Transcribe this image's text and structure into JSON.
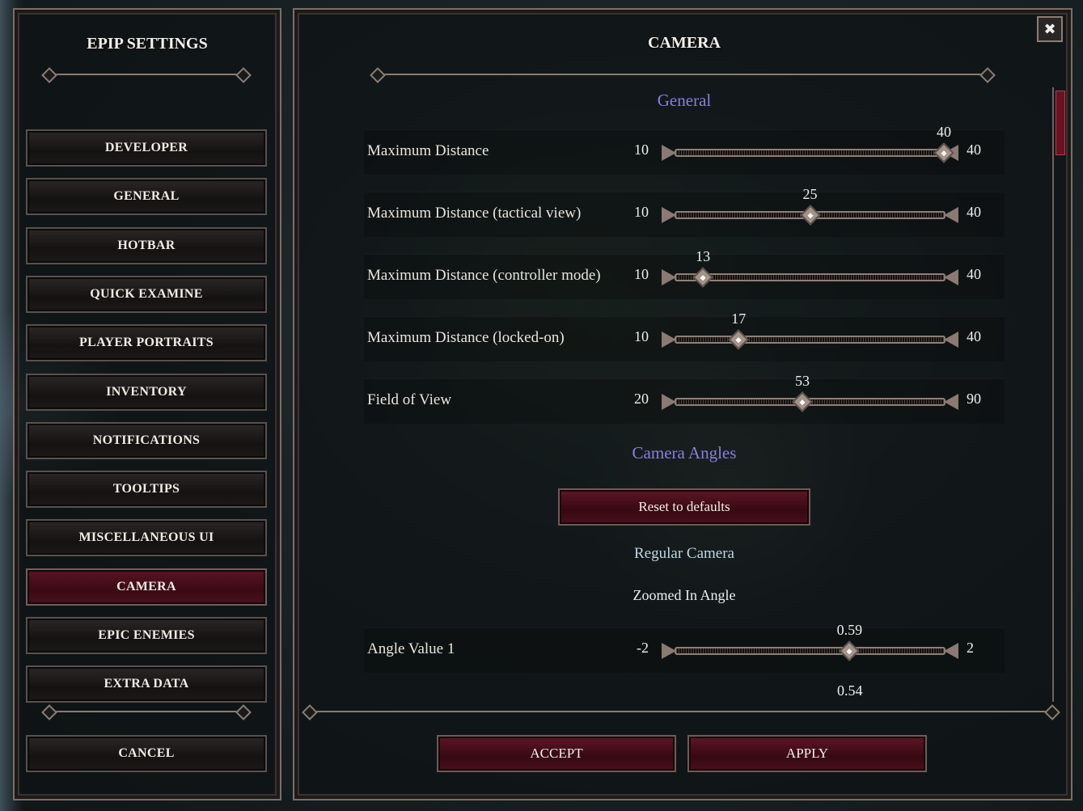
{
  "sidebar": {
    "title": "EPIP SETTINGS",
    "items": [
      {
        "label": "DEVELOPER"
      },
      {
        "label": "GENERAL"
      },
      {
        "label": "HOTBAR"
      },
      {
        "label": "QUICK EXAMINE"
      },
      {
        "label": "PLAYER PORTRAITS"
      },
      {
        "label": "INVENTORY"
      },
      {
        "label": "NOTIFICATIONS"
      },
      {
        "label": "TOOLTIPS"
      },
      {
        "label": "MISCELLANEOUS UI"
      },
      {
        "label": "CAMERA",
        "active": true
      },
      {
        "label": "EPIC ENEMIES"
      },
      {
        "label": "EXTRA DATA"
      }
    ],
    "cancel_label": "CANCEL"
  },
  "main": {
    "title": "CAMERA",
    "close_icon": "close-icon",
    "section_general": "General",
    "sliders": [
      {
        "label": "Maximum Distance",
        "min": "10",
        "max": "40",
        "value": "40"
      },
      {
        "label": "Maximum Distance (tactical view)",
        "min": "10",
        "max": "40",
        "value": "25"
      },
      {
        "label": "Maximum Distance (controller mode)",
        "min": "10",
        "max": "40",
        "value": "13"
      },
      {
        "label": "Maximum Distance (locked-on)",
        "min": "10",
        "max": "40",
        "value": "17"
      },
      {
        "label": "Field of View",
        "min": "20",
        "max": "90",
        "value": "53"
      }
    ],
    "section_angles": "Camera Angles",
    "reset_label": "Reset to defaults",
    "regular_camera": "Regular Camera",
    "zoomed_in_angle": "Zoomed In Angle",
    "angle_slider": {
      "label": "Angle Value 1",
      "min": "-2",
      "max": "2",
      "value": "0.59"
    },
    "next_value": "0.54",
    "accept_label": "ACCEPT",
    "apply_label": "APPLY"
  },
  "colors": {
    "accent_red": "#5e1626",
    "section": "#8a7ee0"
  }
}
